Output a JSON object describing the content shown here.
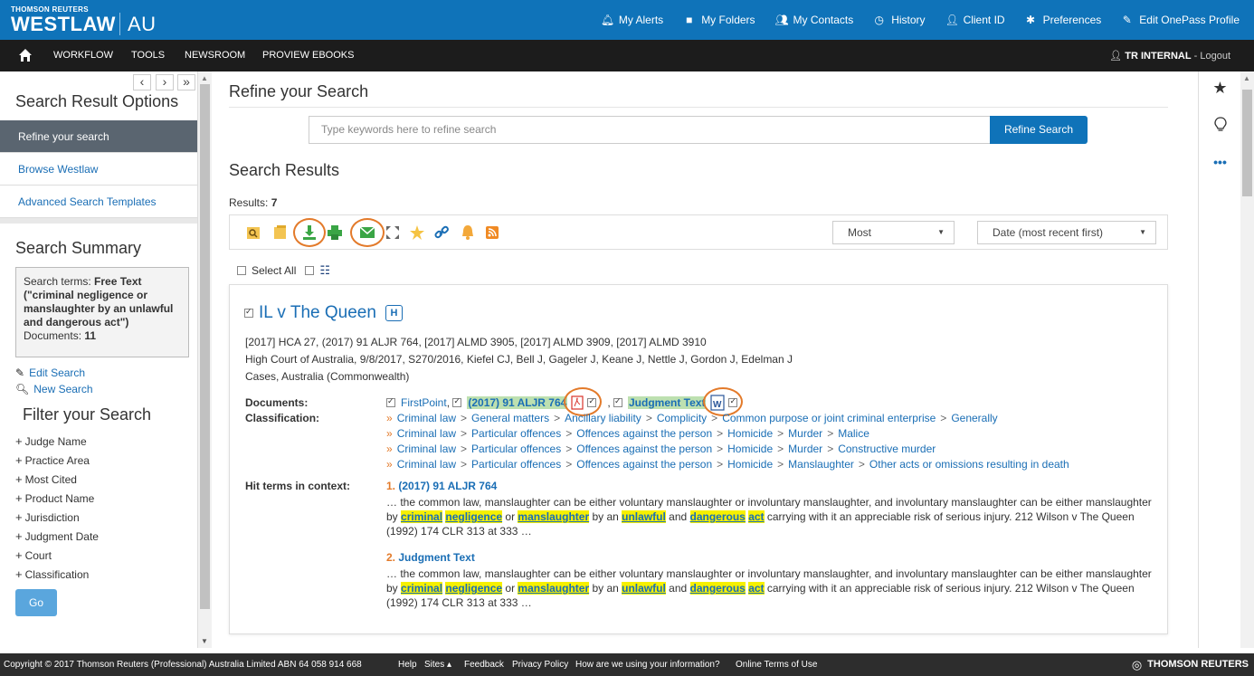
{
  "brand": {
    "company": "THOMSON REUTERS",
    "product": "WESTLAW",
    "region": "AU"
  },
  "topnav": [
    {
      "label": "My Alerts",
      "icon": "bell-icon"
    },
    {
      "label": "My Folders",
      "icon": "folder-icon"
    },
    {
      "label": "My Contacts",
      "icon": "contacts-icon"
    },
    {
      "label": "History",
      "icon": "history-icon"
    },
    {
      "label": "Client ID",
      "icon": "user-icon"
    },
    {
      "label": "Preferences",
      "icon": "gear-icon"
    },
    {
      "label": "Edit OnePass Profile",
      "icon": "edit-icon"
    }
  ],
  "navbar": {
    "items": [
      "WORKFLOW",
      "TOOLS",
      "NEWSROOM",
      "PROVIEW EBOOKS"
    ],
    "user": "TR INTERNAL",
    "logout": " - Logout"
  },
  "sidebar": {
    "pager": {
      "prev": "‹",
      "next": "›",
      "collapse": "»"
    },
    "options_title": "Search Result Options",
    "nav": [
      "Refine your search",
      "Browse Westlaw",
      "Advanced Search Templates"
    ],
    "summary_title": "Search Summary",
    "summary": {
      "terms_label": "Search terms: ",
      "terms_value": "Free Text (\"criminal negligence or manslaughter by an unlawful and dangerous act\")",
      "docs_label": "Documents: ",
      "docs_value": "11"
    },
    "edit_search": "Edit Search",
    "new_search": "New Search",
    "filter_title": "Filter your Search",
    "filters": [
      "Judge Name",
      "Practice Area",
      "Most Cited",
      "Product Name",
      "Jurisdiction",
      "Judgment Date",
      "Court",
      "Classification"
    ],
    "go": "Go"
  },
  "main": {
    "refine_title": "Refine your Search",
    "refine_placeholder": "Type keywords here to refine search",
    "refine_button": "Refine Search",
    "results_title": "Search Results",
    "results_label": "Results: ",
    "results_count": "7",
    "view_select": "Most",
    "sort_select": "Date (most recent first)",
    "select_all": "Select All"
  },
  "result": {
    "title": "IL v The Queen",
    "badge": "H",
    "citations": "[2017] HCA 27, (2017) 91 ALJR 764, [2017] ALMD 3905, [2017] ALMD 3909, [2017] ALMD 3910",
    "court_line": "High Court of Australia, 9/8/2017, S270/2016, Kiefel CJ, Bell J, Gageler J, Keane J, Nettle J, Gordon J, Edelman J",
    "jurisdiction": "Cases, Australia (Commonwealth)",
    "documents_label": "Documents:",
    "classification_label": "Classification:",
    "hits_label": "Hit terms in context:",
    "docs": {
      "firstpoint": "FirstPoint",
      "report": "(2017) 91 ALJR 764",
      "judgment": "Judgment Text"
    },
    "classifications": [
      [
        "Criminal law",
        "General matters",
        "Ancillary liability",
        "Complicity",
        "Common purpose or joint criminal enterprise",
        "Generally"
      ],
      [
        "Criminal law",
        "Particular offences",
        "Offences against the person",
        "Homicide",
        "Murder",
        "Malice"
      ],
      [
        "Criminal law",
        "Particular offences",
        "Offences against the person",
        "Homicide",
        "Murder",
        "Constructive murder"
      ],
      [
        "Criminal law",
        "Particular offences",
        "Offences against the person",
        "Homicide",
        "Manslaughter",
        "Other acts or omissions resulting in death"
      ]
    ],
    "hits": [
      {
        "n": "1.",
        "source": "(2017) 91 ALJR 764"
      },
      {
        "n": "2.",
        "source": "Judgment Text"
      }
    ],
    "snippet": {
      "pre": "… the common law, manslaughter can be either voluntary manslaughter or involuntary manslaughter, and involuntary manslaughter can be either manslaughter by ",
      "k1": "criminal",
      "k2": "negligence",
      "or": " or ",
      "k3": "manslaughter",
      "by": " by an ",
      "k4": "unlawful",
      "and": " and ",
      "k5": "dangerous",
      "k6": "act",
      "post": " carrying with it an appreciable risk of serious injury. 212 Wilson v The Queen (1992) 174 CLR 313 at 333 …"
    }
  },
  "footer": {
    "copyright": "Copyright © 2017 Thomson Reuters (Professional) Australia Limited ABN 64 058 914 668",
    "links": [
      "Help",
      "Sites ▴",
      "Feedback",
      "Privacy Policy",
      "How are we using your information?",
      "Online Terms of Use"
    ],
    "logo": "THOMSON REUTERS"
  },
  "colors": {
    "brand_blue": "#0f73b9",
    "nav_dark": "#1c1c1c",
    "highlight": "#f6f000",
    "accent_orange": "#e37a2a",
    "doc_green": "#bde0b0"
  }
}
